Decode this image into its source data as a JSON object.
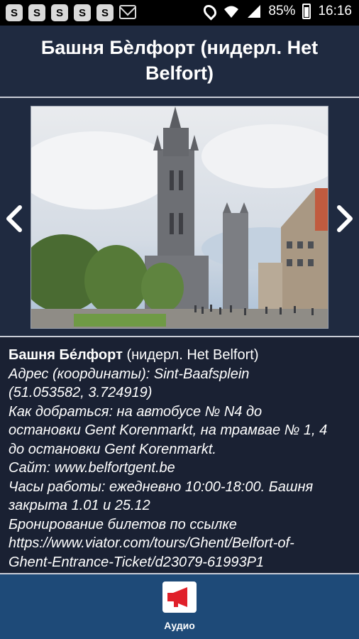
{
  "status_bar": {
    "notification_icons": [
      "S",
      "S",
      "S",
      "S",
      "S"
    ],
    "battery": "85%",
    "time": "16:16"
  },
  "header": {
    "title": "Башня Бѐлфорт (нидерл. Het Belfort)"
  },
  "gallery": {
    "prev_icon": "chevron-left-icon",
    "next_icon": "chevron-right-icon"
  },
  "info": {
    "name": "Башня Бе́лфорт",
    "name_suffix": " (нидерл. Het Belfort)",
    "address_line1": "Адрес (координаты): Sint-Baafsplein",
    "address_line2": "(51.053582, 3.724919)",
    "directions_line1": "Как добраться: на автобусе № N4 до",
    "directions_line2": "остановки Gent Korenmarkt, на трамвае № 1, 4",
    "directions_line3": "до остановки Gent Korenmarkt.",
    "site": "Сайт: www.belfortgent.be",
    "hours_line1": "Часы работы: ежедневно 10:00-18:00. Башня",
    "hours_line2": "закрыта 1.01 и 25.12",
    "booking_line1": "Бронирование билетов по ссылке",
    "booking_line2": "https://www.viator.com/tours/Ghent/Belfort-of-",
    "booking_line3": "Ghent-Entrance-Ticket/d23079-61993P1"
  },
  "bottom": {
    "audio_label": "Аудио",
    "accent": "#e0202a"
  }
}
